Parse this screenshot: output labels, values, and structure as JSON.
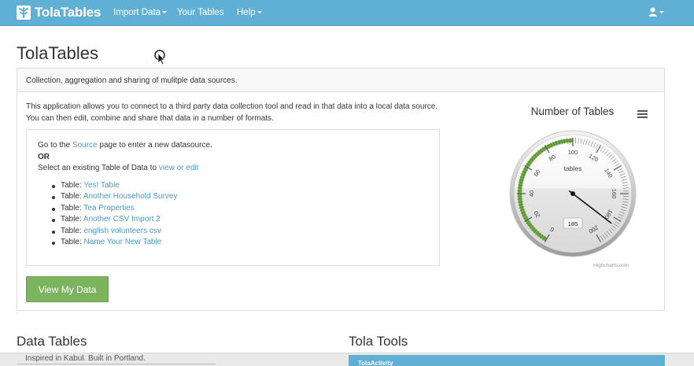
{
  "navbar": {
    "brand": "TolaTables",
    "items": [
      {
        "label": "Import Data",
        "has_caret": true
      },
      {
        "label": "Your Tables",
        "has_caret": false
      },
      {
        "label": "Help",
        "has_caret": true
      }
    ]
  },
  "page": {
    "title": "TolaTables",
    "panel_heading": "Collection, aggregation and sharing of mulitple data sources.",
    "intro": "This application allows you to connect to a third party data collection tool and read in that data into a local data source. You can then edit, combine and share that data in a number of formats.",
    "source_prefix": "Go to the ",
    "source_link": "Source",
    "source_suffix": " page to enter a new datasource.",
    "or": "OR",
    "existing_prefix": "Select an existing Table of Data to ",
    "existing_link": "view or edit",
    "table_prefix": "Table: ",
    "tables": [
      "Yes! Table",
      "Another Household Survey",
      "Tea Properties",
      "Another CSV Import 2",
      "english volunteers csv",
      "Name Your New Table"
    ],
    "view_button": "View My Data"
  },
  "chart_data": {
    "type": "gauge",
    "title": "Number of Tables",
    "unit_label": "tables",
    "value": 185,
    "min": 0,
    "max": 200,
    "tick_labels": [
      "0",
      "20",
      "40",
      "60",
      "80",
      "100",
      "120",
      "140",
      "160",
      "180",
      "200"
    ],
    "band_color": "#6aaa3a",
    "credit": "Highcharts.com"
  },
  "sections": {
    "data_tables": "Data Tables",
    "tola_tools": "Tola Tools",
    "tola_activity": "TolaActivity"
  },
  "footer": {
    "text": "Inspired in Kabul. Built in Portland."
  },
  "colors": {
    "navbar": "#5fb0d4",
    "link": "#4a9bc7",
    "button": "#7cb35e"
  }
}
